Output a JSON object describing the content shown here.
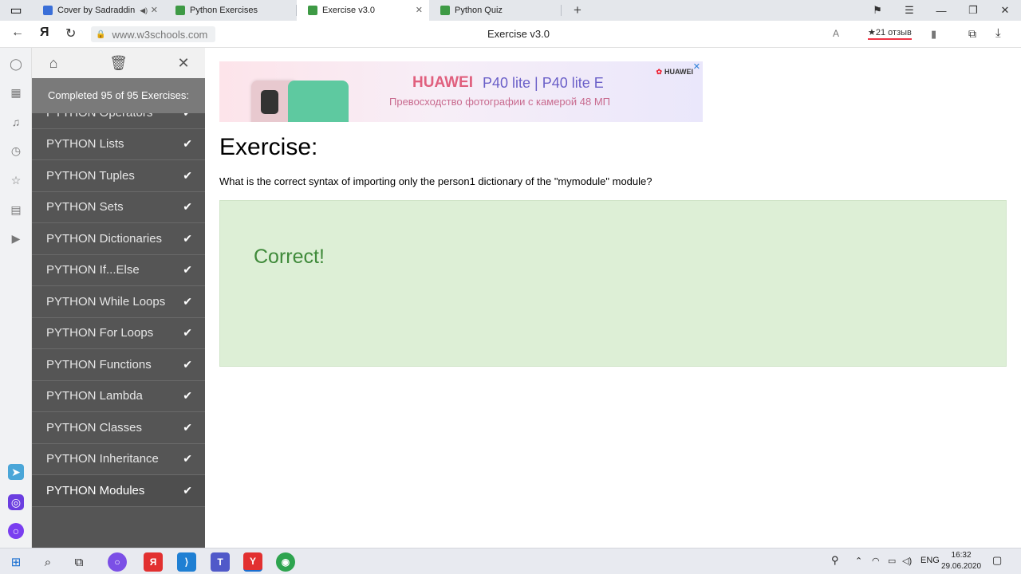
{
  "tabs": [
    {
      "title": "Cover by Sadraddin",
      "icon": "video-icon",
      "muted": true
    },
    {
      "title": "Python Exercises",
      "icon": "w3-icon"
    },
    {
      "title": "Exercise v3.0",
      "icon": "w3-icon",
      "active": true
    },
    {
      "title": "Python Quiz",
      "icon": "w3-icon"
    }
  ],
  "address": {
    "url": "www.w3schools.com",
    "page_title": "Exercise v3.0",
    "reviews": "★21 отзыв"
  },
  "sidebar": {
    "status": "Completed 95 of 95 Exercises:",
    "items": [
      {
        "label": "PYTHON Operators"
      },
      {
        "label": "PYTHON Lists"
      },
      {
        "label": "PYTHON Tuples"
      },
      {
        "label": "PYTHON Sets"
      },
      {
        "label": "PYTHON Dictionaries"
      },
      {
        "label": "PYTHON If...Else"
      },
      {
        "label": "PYTHON While Loops"
      },
      {
        "label": "PYTHON For Loops"
      },
      {
        "label": "PYTHON Functions"
      },
      {
        "label": "PYTHON Lambda"
      },
      {
        "label": "PYTHON Classes"
      },
      {
        "label": "PYTHON Inheritance"
      },
      {
        "label": "PYTHON Modules"
      }
    ],
    "check": "✔"
  },
  "ad": {
    "brand": "HUAWEI",
    "model": "P40 lite | P40 lite E",
    "subtitle": "Превосходство фотографии с камерой 48 МП",
    "logo": "HUAWEI"
  },
  "exercise": {
    "heading": "Exercise:",
    "question": "What is the correct syntax of importing only the person1 dictionary of the \"mymodule\" module?",
    "result": "Correct!"
  },
  "taskbar": {
    "lang": "ENG",
    "time": "16:32",
    "date": "29.06.2020"
  },
  "colors": {
    "sidebar_bg": "#555555",
    "result_bg": "#ddefd6",
    "result_text": "#3f8a3a"
  }
}
